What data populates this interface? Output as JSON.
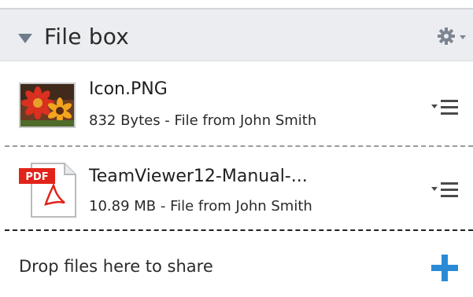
{
  "header": {
    "title": "File box",
    "collapse_icon": "triangle-down-icon",
    "settings_icon": "gear-icon",
    "accent": "#6e7c8c"
  },
  "files": [
    {
      "name": "Icon.PNG",
      "meta": "832 Bytes - File from John Smith",
      "icon": "image-thumbnail-icon",
      "menu_icon": "menu-dropdown-icon"
    },
    {
      "name": "TeamViewer12-Manual-...",
      "meta": "10.89 MB - File from John Smith",
      "icon": "pdf-file-icon",
      "icon_badge": "PDF",
      "menu_icon": "menu-dropdown-icon"
    }
  ],
  "drop_zone": {
    "label": "Drop files here to share",
    "add_icon": "plus-icon",
    "add_color": "#2b8ad6"
  }
}
